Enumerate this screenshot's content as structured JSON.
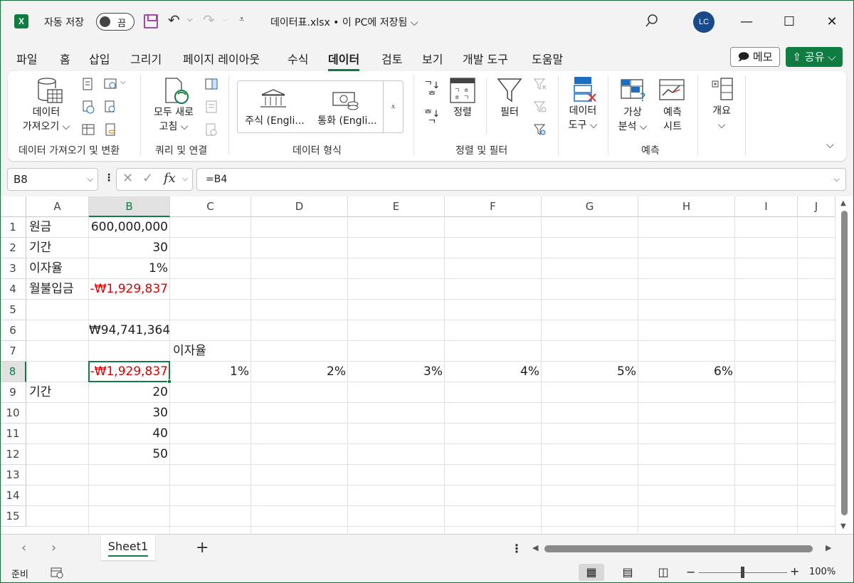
{
  "titlebar": {
    "app_icon": "X",
    "autosave_label": "자동 저장",
    "autosave_state": "끔",
    "doc_title": "데이터표.xlsx • 이 PC에 저장됨",
    "doc_title_chevron": "⌵",
    "avatar_initials": "LC",
    "minimize": "—",
    "maximize": "☐",
    "close": "✕"
  },
  "tabs": [
    {
      "label": "파일"
    },
    {
      "label": "홈"
    },
    {
      "label": "삽입"
    },
    {
      "label": "그리기"
    },
    {
      "label": "페이지 레이아웃"
    },
    {
      "label": "수식"
    },
    {
      "label": "데이터",
      "active": true
    },
    {
      "label": "검토"
    },
    {
      "label": "보기"
    },
    {
      "label": "개발 도구"
    },
    {
      "label": "도움말"
    }
  ],
  "memo_button": "🗩 메모",
  "share_button": "⇧ 공유 ⌵",
  "ribbon": {
    "get_data_label": "데이터\n가져오기 ⌵",
    "group1_label": "데이터 가져오기 및 변환",
    "refresh_label": "모두 새로\n고침 ⌵",
    "group2_label": "쿼리 및 연결",
    "stocks_label": "주식 (Engli...",
    "currency_label": "통화 (Engli...",
    "group3_label": "데이터 형식",
    "sort_label": "정렬",
    "filter_label": "필터",
    "group4_label": "정렬 및 필터",
    "data_tools_label": "데이터\n도구 ⌵",
    "whatif_label": "가상\n분석 ⌵",
    "forecast_sheet_label": "예측\n시트",
    "group5_label": "예측",
    "outline_label": "개요\n⌵"
  },
  "formula_bar": {
    "name_box": "B8",
    "formula": "=B4"
  },
  "columns": [
    "A",
    "B",
    "C",
    "D",
    "E",
    "F",
    "G",
    "H",
    "I",
    "J"
  ],
  "rows": [
    "1",
    "2",
    "3",
    "4",
    "5",
    "6",
    "7",
    "8",
    "9",
    "10",
    "11",
    "12",
    "13",
    "14",
    "15"
  ],
  "cells": {
    "A1": "원금",
    "B1": "600,000,000",
    "A2": "기간",
    "B2": "30",
    "A3": "이자율",
    "B3": "1%",
    "A4": "월불입금",
    "B4": "-₩1,929,837",
    "B6": "₩94,741,364",
    "C7": "이자율",
    "B8": "-₩1,929,837",
    "C8": "1%",
    "D8": "2%",
    "E8": "3%",
    "F8": "4%",
    "G8": "5%",
    "H8": "6%",
    "A9": "기간",
    "B9": "20",
    "B10": "30",
    "B11": "40",
    "B12": "50"
  },
  "selected_cell": "B8",
  "sheet": {
    "name": "Sheet1",
    "add": "+"
  },
  "status": {
    "ready": "준비",
    "zoom": "100%"
  },
  "colors": {
    "accent": "#107c41",
    "negative": "#e00000",
    "avatar": "#1a4a8a",
    "save_icon": "#a349a4"
  }
}
